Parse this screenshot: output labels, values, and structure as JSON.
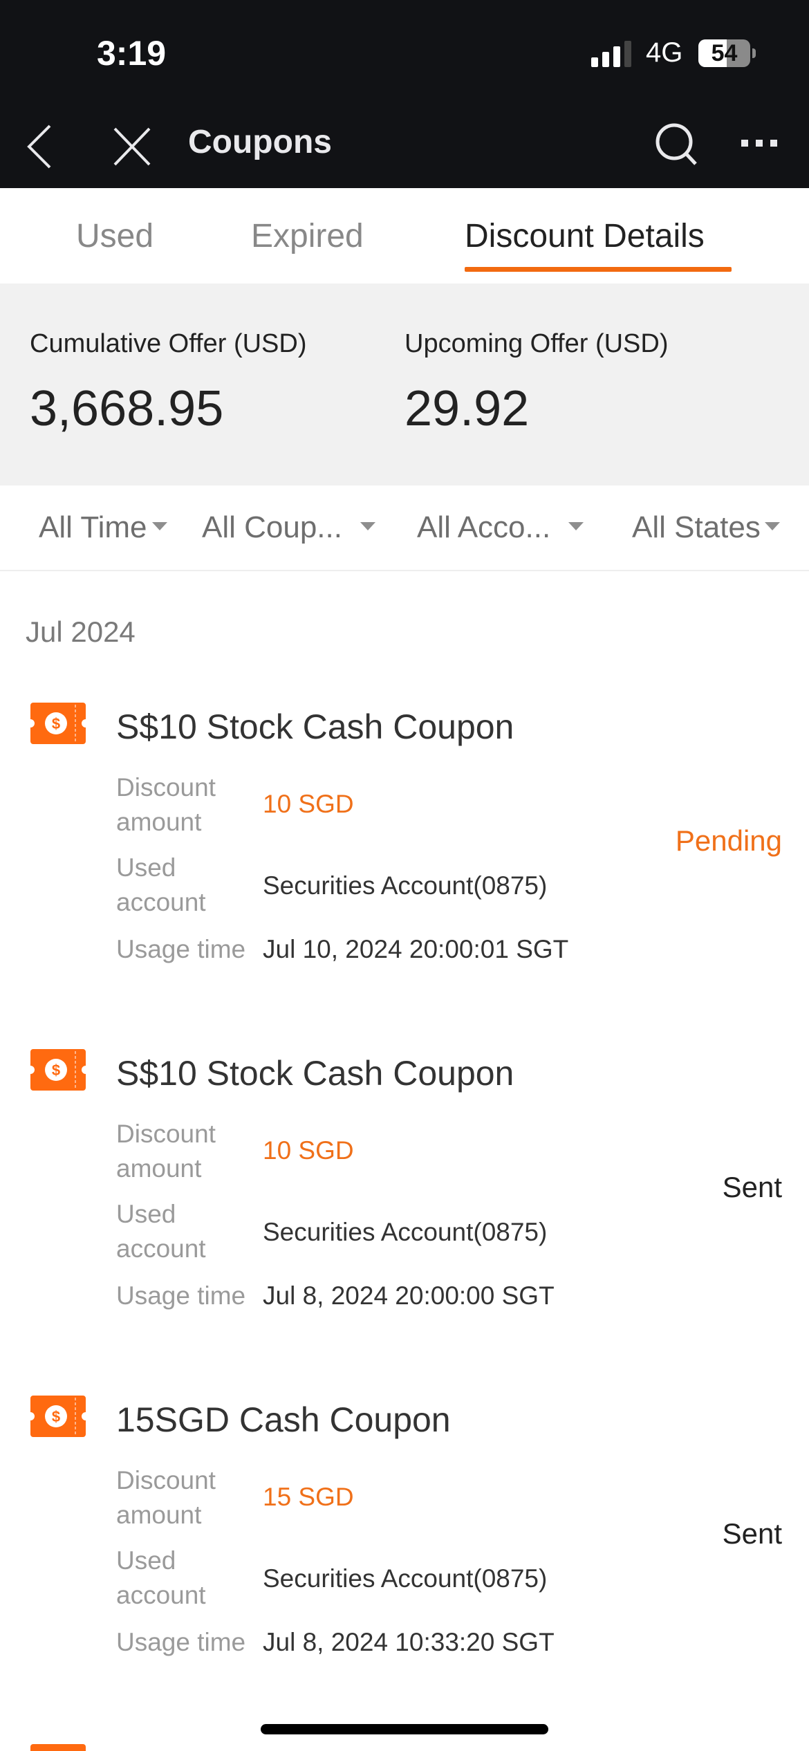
{
  "status_bar": {
    "time": "3:19",
    "network": "4G",
    "battery_percent": 54
  },
  "nav": {
    "title": "Coupons",
    "back_icon": "chevron-left-icon",
    "close_icon": "close-icon",
    "search_icon": "search-icon",
    "more_icon": "more-icon"
  },
  "tabs": [
    {
      "label": "Used",
      "active": false
    },
    {
      "label": "Expired",
      "active": false
    },
    {
      "label": "Discount Details",
      "active": true
    }
  ],
  "summary": {
    "cumulative_label": "Cumulative Offer (USD)",
    "cumulative_value": "3,668.95",
    "upcoming_label": "Upcoming Offer (USD)",
    "upcoming_value": "29.92"
  },
  "filters": [
    {
      "label": "All Time"
    },
    {
      "label": "All Coup..."
    },
    {
      "label": "All Acco..."
    },
    {
      "label": "All States"
    }
  ],
  "list": {
    "month": "Jul 2024",
    "labels": {
      "discount_line1": "Discount",
      "discount_line2": "amount",
      "account_line1": "Used",
      "account_line2": "account",
      "usage_time": "Usage time"
    },
    "coupons": [
      {
        "title": "S$10 Stock Cash Coupon",
        "discount_amount": "10 SGD",
        "used_account": "Securities Account(0875)",
        "usage_time": "Jul 10, 2024 20:00:01 SGT",
        "status": "Pending"
      },
      {
        "title": "S$10 Stock Cash Coupon",
        "discount_amount": "10 SGD",
        "used_account": "Securities Account(0875)",
        "usage_time": "Jul 8, 2024 20:00:00 SGT",
        "status": "Sent"
      },
      {
        "title": "15SGD Cash Coupon",
        "discount_amount": "15 SGD",
        "used_account": "Securities Account(0875)",
        "usage_time": "Jul 8, 2024 10:33:20 SGT",
        "status": "Sent"
      }
    ]
  },
  "colors": {
    "accent": "#f26a10",
    "header_bg": "#111215",
    "summary_bg": "#f1f1f1"
  }
}
